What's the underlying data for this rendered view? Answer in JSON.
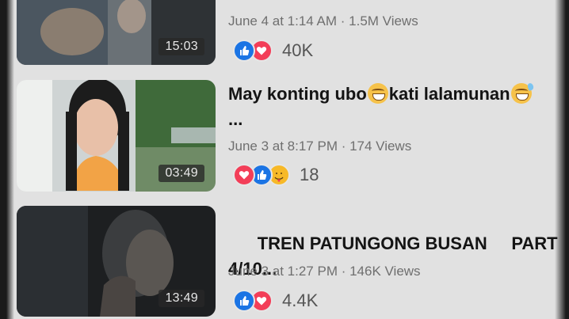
{
  "videos": [
    {
      "title_tail": "...",
      "meta": "June 4 at 1:14 AM · 1.5M Views",
      "duration": "15:03",
      "reaction_count": "40K",
      "reactions": [
        "like-icon",
        "love-icon"
      ]
    },
    {
      "title_text": "May konting ubo",
      "title_text2": "kati lalamunan",
      "title_line2": "...",
      "emoji1": "grinning-face-emoji",
      "emoji2": "grinning-sweat-emoji",
      "meta": "June 3 at 8:17 PM · 174 Views",
      "duration": "03:49",
      "reaction_count": "18",
      "reactions": [
        "love-icon",
        "like-icon",
        "care-icon"
      ]
    },
    {
      "title_line1": "TREN PATUNGONG BUSAN     PART",
      "title_line2": "4/10...",
      "meta": "June 3 at 1:27 PM · 146K Views",
      "duration": "13:49",
      "reaction_count": "4.4K",
      "reactions": [
        "like-icon",
        "love-icon"
      ]
    }
  ]
}
